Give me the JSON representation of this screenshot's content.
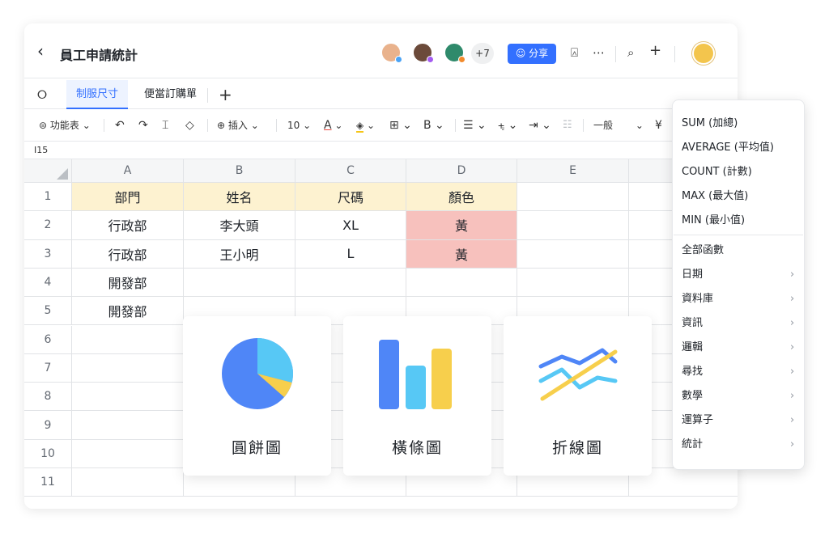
{
  "header": {
    "back_icon": "chevron-left-icon",
    "title": "員工申請統計",
    "collaborators_more": "+7",
    "share_label": "分享",
    "icons": [
      "present-icon",
      "more-icon",
      "search-icon",
      "plus-icon"
    ],
    "colors": {
      "accent": "#3370ff"
    }
  },
  "tabs": [
    {
      "label": "制服尺寸",
      "active": true
    },
    {
      "label": "便當訂購單",
      "active": false
    }
  ],
  "toolbar": {
    "function_table": "功能表",
    "insert": "插入",
    "font_size": "10",
    "font_color_letter": "A",
    "bold_letter": "B",
    "number_format": "一般",
    "currency": "¥"
  },
  "formula_bar": {
    "cell_ref": "I15"
  },
  "sheet": {
    "columns": [
      "A",
      "B",
      "C",
      "D",
      "E"
    ],
    "rows": [
      "1",
      "2",
      "3",
      "4",
      "5",
      "6",
      "7",
      "8",
      "9",
      "10",
      "11"
    ],
    "cells": [
      [
        "部門",
        "姓名",
        "尺碼",
        "顏色",
        ""
      ],
      [
        "行政部",
        "李大頭",
        "XL",
        "黃",
        ""
      ],
      [
        "行政部",
        "王小明",
        "L",
        "黃",
        ""
      ],
      [
        "開發部",
        "",
        "",
        "",
        ""
      ],
      [
        "開發部",
        "",
        "",
        "",
        ""
      ]
    ],
    "colors": {
      "header_fill": "#fdf2d0",
      "highlight_fill": "#f7c1bd"
    }
  },
  "chart_cards": [
    {
      "label": "圓餅圖",
      "icon": "pie-chart-icon"
    },
    {
      "label": "橫條圖",
      "icon": "bar-chart-icon"
    },
    {
      "label": "折線圖",
      "icon": "line-chart-icon"
    }
  ],
  "function_menu": {
    "quick": [
      "SUM (加總)",
      "AVERAGE (平均值)",
      "COUNT (計數)",
      "MAX (最大值)",
      "MIN (最小值)"
    ],
    "all": "全部函數",
    "categories": [
      "日期",
      "資料庫",
      "資訊",
      "邏輯",
      "尋找",
      "數學",
      "運算子",
      "統計"
    ]
  }
}
